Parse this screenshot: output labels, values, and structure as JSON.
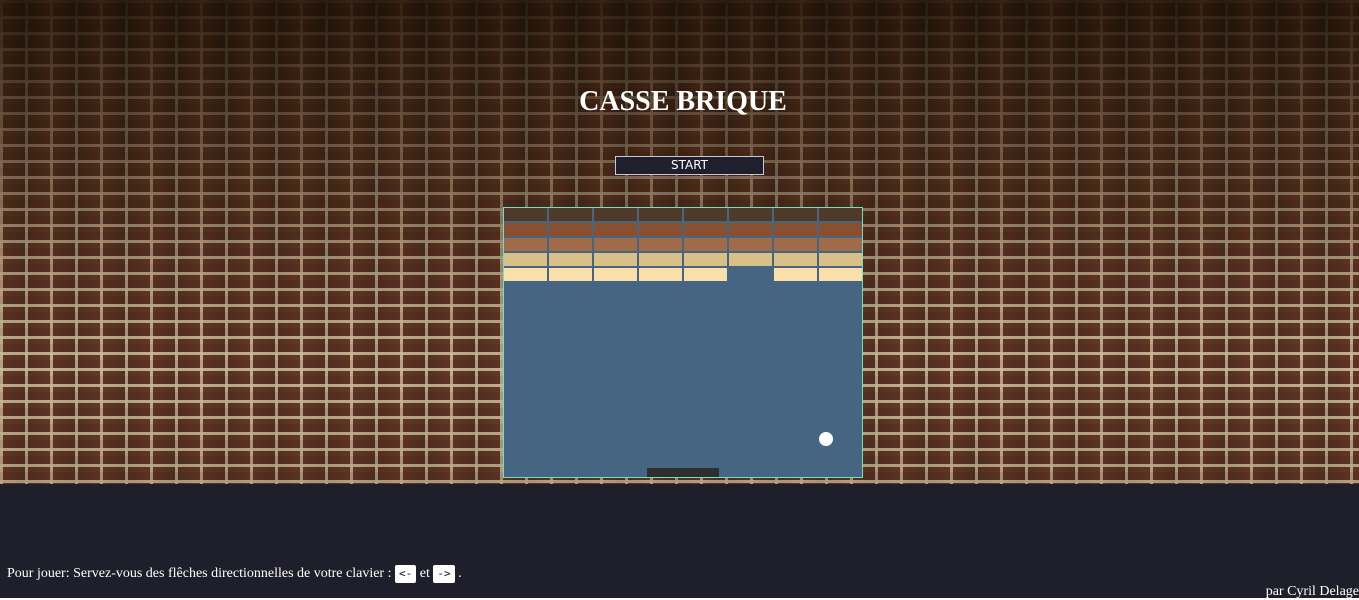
{
  "page": {
    "title": "CASSE BRIQUE",
    "start_label": "START"
  },
  "colors": {
    "canvas_background": "#466582",
    "canvas_border": "#6fe0c0",
    "footer_background": "#1f1f2b",
    "paddle": "#2e2e2e",
    "ball": "#ffffff"
  },
  "game": {
    "columns": 8,
    "rows": [
      {
        "color": "#4e3a2a",
        "bricks": [
          1,
          1,
          1,
          1,
          1,
          1,
          1,
          1
        ]
      },
      {
        "color": "#8a4f2f",
        "bricks": [
          1,
          1,
          1,
          1,
          1,
          1,
          1,
          1
        ]
      },
      {
        "color": "#a06b48",
        "bricks": [
          1,
          1,
          1,
          1,
          1,
          1,
          1,
          1
        ]
      },
      {
        "color": "#d9bf88",
        "bricks": [
          1,
          1,
          1,
          1,
          1,
          1,
          1,
          1
        ]
      },
      {
        "color": "#fadfaa",
        "bricks": [
          1,
          1,
          1,
          1,
          1,
          0,
          1,
          1
        ]
      }
    ]
  },
  "footer": {
    "instructions_prefix": "Pour jouer: Servez-vous des flêches directionnelles de votre clavier :",
    "key_left": "<-",
    "conjunction": "et",
    "key_right": "->",
    "suffix": ".",
    "author": "par Cyril Delage"
  }
}
